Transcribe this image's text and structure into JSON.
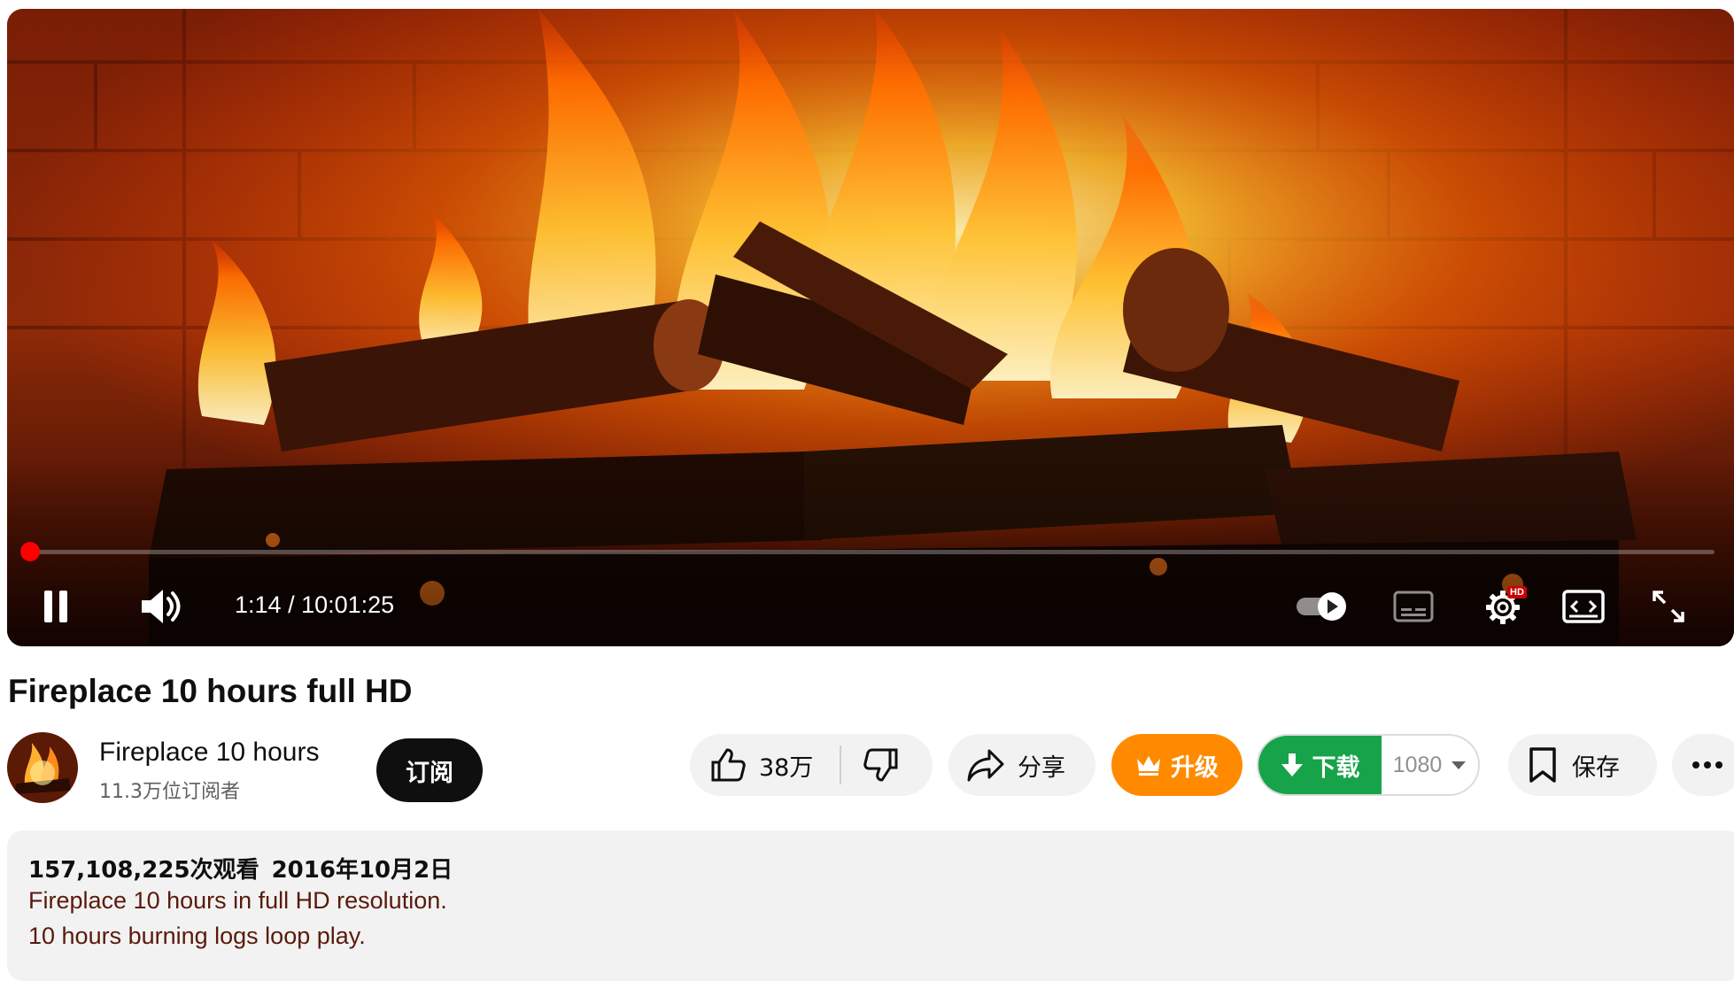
{
  "video": {
    "title": "Fireplace 10 hours full HD",
    "current_time": "1:14",
    "separator": " / ",
    "duration": "10:01:25",
    "progress_fraction": 0.002,
    "autoplay_on": true,
    "settings_badge": "HD"
  },
  "channel": {
    "name": "Fireplace 10 hours",
    "subscribers": "11.3万位订阅者",
    "subscribe_label": "订阅"
  },
  "actions": {
    "likes": "38万",
    "share_label": "分享",
    "upgrade_label": "升级",
    "download_label": "下载",
    "download_quality": "1080",
    "save_label": "保存"
  },
  "description": {
    "views": "157,108,225次观看",
    "date": "2016年10月2日",
    "lines": [
      "Fireplace 10 hours in full HD resolution.",
      "10 hours burning logs loop play."
    ]
  },
  "colors": {
    "progress_red": "#ff0000",
    "upgrade_orange": "#ff8a00",
    "download_green": "#17a34a"
  }
}
